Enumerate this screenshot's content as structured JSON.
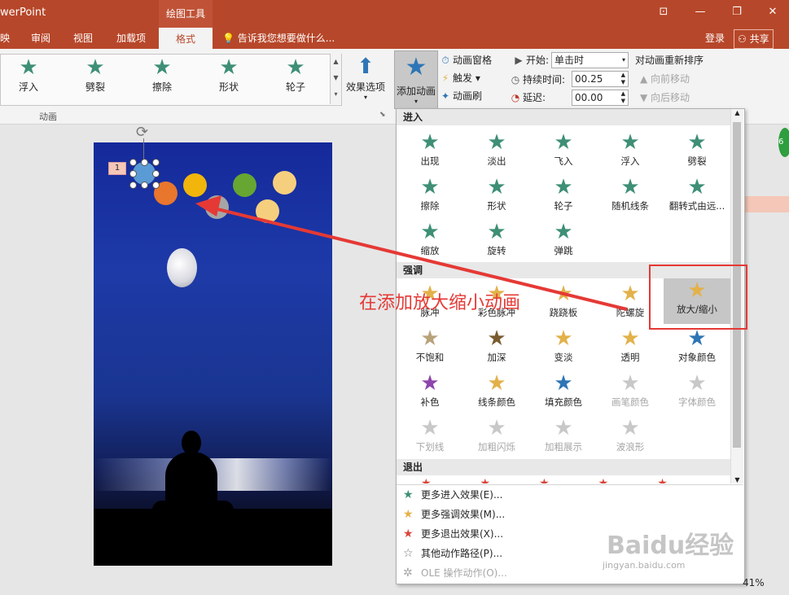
{
  "title": {
    "app": "werPoint",
    "context_tab": "绘图工具",
    "window_buttons": [
      "⊡",
      "—",
      "❐",
      "✕"
    ]
  },
  "tabs": [
    "映",
    "审阅",
    "视图",
    "加载项",
    "格式"
  ],
  "tellme": "告诉我您想要做什么...",
  "account": {
    "login": "登录",
    "share": "共享"
  },
  "ribbon": {
    "gallery": [
      "浮入",
      "劈裂",
      "擦除",
      "形状",
      "轮子"
    ],
    "group_label": "动画",
    "effect_options": "效果选项",
    "add_animation": "添加动画",
    "animation_pane": "动画窗格",
    "trigger": "触发",
    "anim_painter": "动画刷",
    "start_label": "开始:",
    "start_value": "单击时",
    "duration_label": "持续时间:",
    "duration_value": "00.25",
    "delay_label": "延迟:",
    "delay_value": "00.00",
    "reorder_title": "对动画重新排序",
    "move_earlier": "向前移动",
    "move_later": "向后移动"
  },
  "slide": {
    "anim_index": "1"
  },
  "dropdown": {
    "enter_header": "进入",
    "enter_effects": [
      "出现",
      "淡出",
      "飞入",
      "浮入",
      "劈裂",
      "擦除",
      "形状",
      "轮子",
      "随机线条",
      "翻转式由远...",
      "缩放",
      "旋转",
      "弹跳"
    ],
    "emphasis_header": "强调",
    "emphasis_effects": [
      "脉冲",
      "彩色脉冲",
      "跷跷板",
      "陀螺旋",
      "放大/缩小",
      "不饱和",
      "加深",
      "变淡",
      "透明",
      "对象颜色",
      "补色",
      "线条颜色",
      "填充颜色",
      "画笔颜色",
      "字体颜色",
      "下划线",
      "加粗闪烁",
      "加粗展示",
      "波浪形"
    ],
    "exit_header": "退出",
    "more": [
      "更多进入效果(E)...",
      "更多强调效果(M)...",
      "更多退出效果(X)...",
      "其他动作路径(P)...",
      "OLE 操作动作(O)..."
    ]
  },
  "annotation": "在添加放大缩小动画",
  "status": {
    "zoom": "41%"
  },
  "watermark": {
    "brand": "Baidu经验",
    "url": "jingyan.baidu.com"
  },
  "colors": {
    "accent": "#b7472a",
    "highlight": "#e53935"
  }
}
